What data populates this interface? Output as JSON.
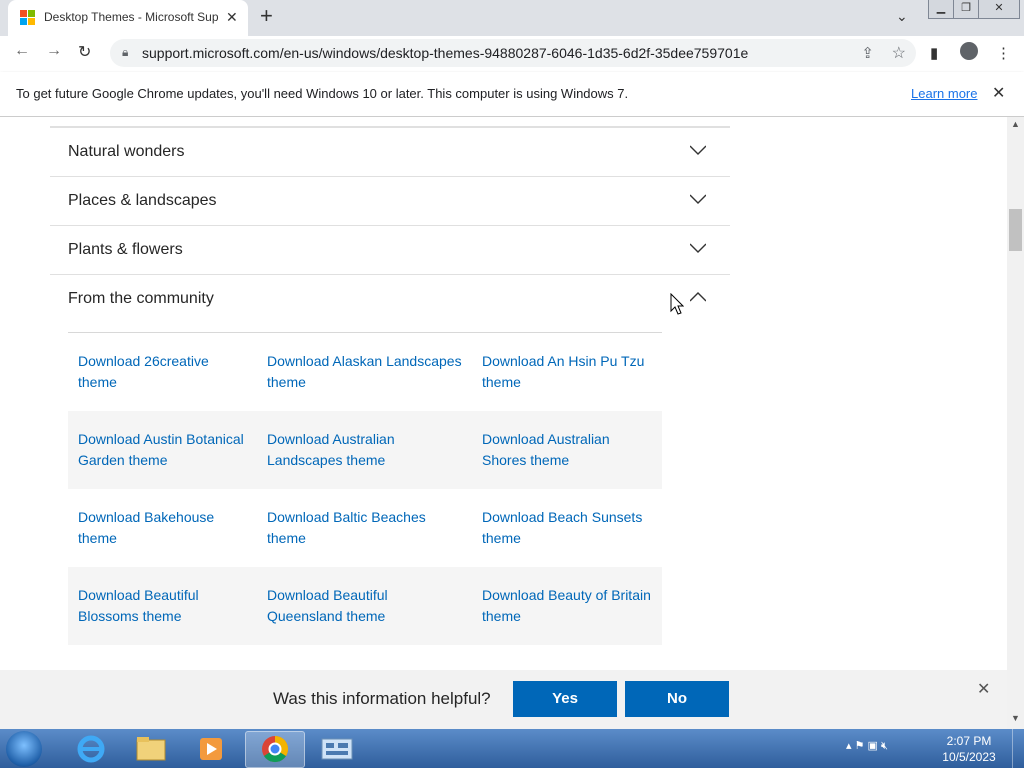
{
  "browser": {
    "tab_title": "Desktop Themes - Microsoft Sup",
    "tab_close": "✕",
    "new_tab": "+",
    "url": "support.microsoft.com/en-us/windows/desktop-themes-94880287-6046-1d35-6d2f-35dee759701e"
  },
  "infobar": {
    "message": "To get future Google Chrome updates, you'll need Windows 10 or later. This computer is using Windows 7.",
    "learn_more": "Learn more",
    "close": "✕"
  },
  "accordion": [
    {
      "label": "Natural wonders",
      "expanded": false
    },
    {
      "label": "Places & landscapes",
      "expanded": false
    },
    {
      "label": "Plants & flowers",
      "expanded": false
    },
    {
      "label": "From the community",
      "expanded": true
    }
  ],
  "themes": [
    [
      "Download 26creative theme",
      "Download Alaskan Landscapes theme",
      "Download An Hsin Pu Tzu theme"
    ],
    [
      "Download Austin Botanical Garden theme",
      "Download Australian Landscapes theme",
      "Download Australian Shores theme"
    ],
    [
      "Download Bakehouse theme",
      "Download Baltic Beaches theme",
      "Download Beach Sunsets theme"
    ],
    [
      "Download Beautiful Blossoms theme",
      "Download Beautiful Queensland theme",
      "Download Beauty of Britain theme"
    ]
  ],
  "feedback": {
    "question": "Was this information helpful?",
    "yes": "Yes",
    "no": "No",
    "close": "✕"
  },
  "taskbar": {
    "time": "2:07 PM",
    "date": "10/5/2023"
  },
  "colors": {
    "link": "#0067b8",
    "button": "#0067b8",
    "infobar_link": "#1a73e8"
  }
}
